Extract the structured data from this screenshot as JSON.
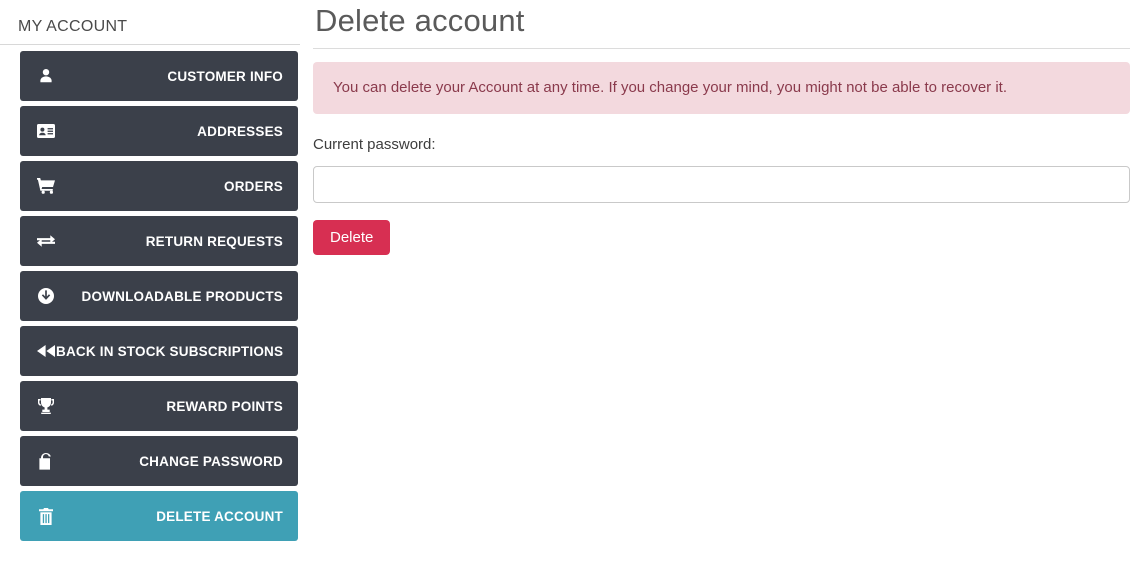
{
  "sidebar": {
    "title": "MY ACCOUNT",
    "items": [
      {
        "label": "CUSTOMER INFO",
        "icon": "user-icon",
        "active": false
      },
      {
        "label": "ADDRESSES",
        "icon": "id-card-icon",
        "active": false
      },
      {
        "label": "ORDERS",
        "icon": "shopping-cart-icon",
        "active": false
      },
      {
        "label": "RETURN REQUESTS",
        "icon": "exchange-arrows-icon",
        "active": false
      },
      {
        "label": "DOWNLOADABLE PRODUCTS",
        "icon": "download-circle-icon",
        "active": false
      },
      {
        "label": "BACK IN STOCK SUBSCRIPTIONS",
        "icon": "backward-icon",
        "active": false
      },
      {
        "label": "REWARD POINTS",
        "icon": "trophy-icon",
        "active": false
      },
      {
        "label": "CHANGE PASSWORD",
        "icon": "unlock-icon",
        "active": false
      },
      {
        "label": "DELETE ACCOUNT",
        "icon": "trash-icon",
        "active": true
      }
    ]
  },
  "main": {
    "title": "Delete account",
    "alert": "You can delete your Account at any time. If you change your mind, you might not be able to recover it.",
    "password_label": "Current password:",
    "password_value": "",
    "password_placeholder": "",
    "delete_label": "Delete"
  },
  "colors": {
    "sidebar_item": "#3b404a",
    "sidebar_active": "#3fa0b5",
    "alert_bg": "#f3d9de",
    "alert_text": "#8a3a4c",
    "delete_button": "#d72f52",
    "title_text": "#5a5a5a"
  }
}
